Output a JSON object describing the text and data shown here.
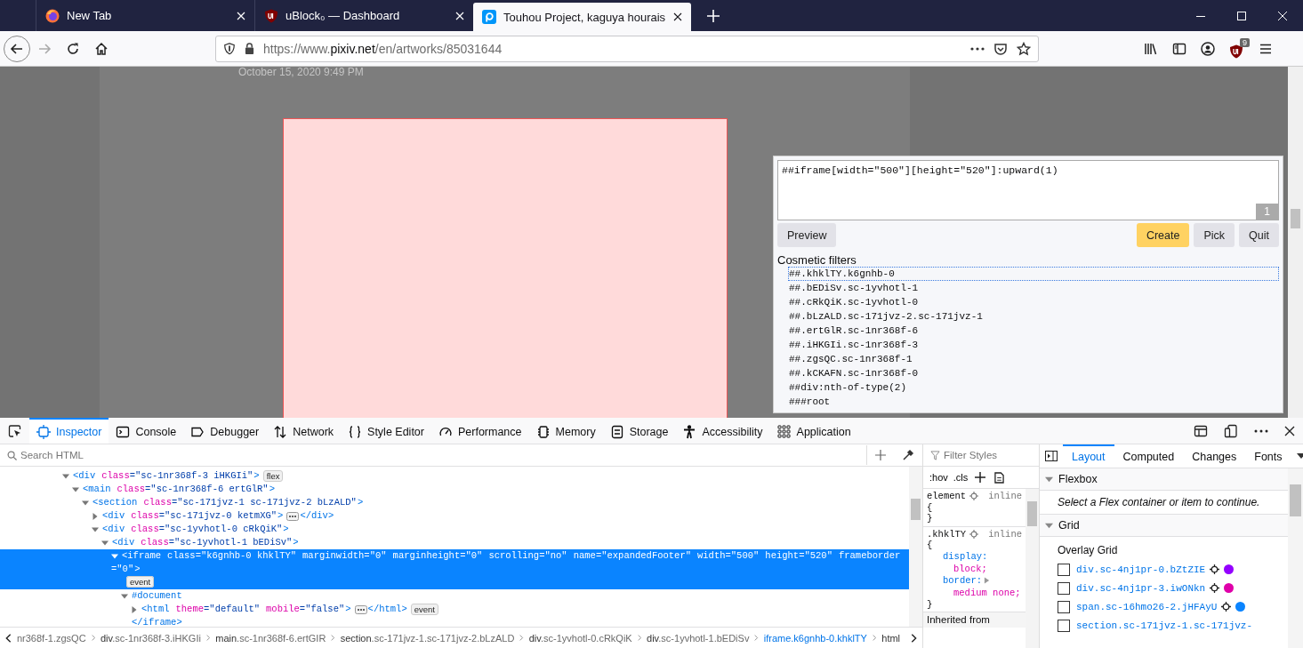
{
  "tabs": [
    {
      "title": "New Tab",
      "selected": false
    },
    {
      "title": "uBlock₀ — Dashboard",
      "selected": false
    },
    {
      "title": "Touhou Project, kaguya hourais",
      "selected": true
    }
  ],
  "address": {
    "prefix": "https://www.",
    "domain": "pixiv.net",
    "path": "/en/artworks/85031644"
  },
  "extension_badge": "9",
  "page": {
    "date": "October 15, 2020 9:49 PM"
  },
  "picker": {
    "filter": "##iframe[width=\"500\"][height=\"520\"]:upward(1)",
    "count": "1",
    "buttons": [
      {
        "label": "Preview",
        "kind": "plain"
      },
      {
        "label": "Create",
        "kind": "primary"
      },
      {
        "label": "Pick",
        "kind": "plain"
      },
      {
        "label": "Quit",
        "kind": "plain"
      }
    ],
    "section_title": "Cosmetic filters",
    "filters": [
      {
        "text": "##.khklTY.k6gnhb-0",
        "selected": true
      },
      {
        "text": "##.bEDiSv.sc-1yvhotl-1",
        "selected": false
      },
      {
        "text": "##.cRkQiK.sc-1yvhotl-0",
        "selected": false
      },
      {
        "text": "##.bLzALD.sc-171jvz-2.sc-171jvz-1",
        "selected": false
      },
      {
        "text": "##.ertGlR.sc-1nr368f-6",
        "selected": false
      },
      {
        "text": "##.iHKGIi.sc-1nr368f-3",
        "selected": false
      },
      {
        "text": "##.zgsQC.sc-1nr368f-1",
        "selected": false
      },
      {
        "text": "##.kCKAFN.sc-1nr368f-0",
        "selected": false
      },
      {
        "text": "##div:nth-of-type(2)",
        "selected": false
      },
      {
        "text": "###root",
        "selected": false
      }
    ]
  },
  "devtools": {
    "tools": [
      {
        "label": "Inspector",
        "selected": true
      },
      {
        "label": "Console",
        "selected": false
      },
      {
        "label": "Debugger",
        "selected": false
      },
      {
        "label": "Network",
        "selected": false
      },
      {
        "label": "Style Editor",
        "selected": false
      },
      {
        "label": "Performance",
        "selected": false
      },
      {
        "label": "Memory",
        "selected": false
      },
      {
        "label": "Storage",
        "selected": false
      },
      {
        "label": "Accessibility",
        "selected": false
      },
      {
        "label": "Application",
        "selected": false
      }
    ],
    "search_placeholder": "Search HTML",
    "tree": [
      {
        "kind": "element",
        "open": "<div",
        "attributes": [
          {
            "name": "class",
            "value": "=\"sc-1nr368f-3 iHKGIi\""
          }
        ],
        "end": ">",
        "badges": [
          "flex"
        ],
        "expanded": true,
        "selected": false,
        "children": [
          {
            "kind": "element",
            "open": "<main",
            "attributes": [
              {
                "name": "class",
                "value": "=\"sc-1nr368f-6 ertGlR\""
              }
            ],
            "end": ">",
            "expanded": true,
            "selected": false,
            "children": [
              {
                "kind": "element",
                "open": "<section",
                "attributes": [
                  {
                    "name": "class",
                    "value": "=\"sc-171jvz-1 sc-171jvz-2 bLzALD\""
                  }
                ],
                "end": ">",
                "expanded": true,
                "selected": false,
                "children": [
                  {
                    "kind": "element",
                    "open": "<div",
                    "attributes": [
                      {
                        "name": "class",
                        "value": "=\"sc-171jvz-0 ketmXG\""
                      }
                    ],
                    "end": ">",
                    "close": "</div>",
                    "expanded": false,
                    "selected": false
                  },
                  {
                    "kind": "element",
                    "open": "<div",
                    "attributes": [
                      {
                        "name": "class",
                        "value": "=\"sc-1yvhotl-0 cRkQiK\""
                      }
                    ],
                    "end": ">",
                    "expanded": true,
                    "selected": false,
                    "children": [
                      {
                        "kind": "element",
                        "open": "<div",
                        "attributes": [
                          {
                            "name": "class",
                            "value": "=\"sc-1yvhotl-1 bEDiSv\""
                          }
                        ],
                        "end": ">",
                        "expanded": true,
                        "selected": false,
                        "children": [
                          {
                            "kind": "element",
                            "open": "<iframe",
                            "attributes": [
                              {
                                "name": "class",
                                "value": "=\"k6gnhb-0 khklTY\""
                              },
                              {
                                "name": "marginwidth",
                                "value": "=\"0\""
                              },
                              {
                                "name": "marginheight",
                                "value": "=\"0\""
                              },
                              {
                                "name": "scrolling",
                                "value": "=\"no\""
                              },
                              {
                                "name": "name",
                                "value": "=\"expandedFooter\""
                              },
                              {
                                "name": "width",
                                "value": "=\"500\""
                              },
                              {
                                "name": "height",
                                "value": "=\"520\""
                              },
                              {
                                "name": "frameborder",
                                "value": "=\"0\""
                              }
                            ],
                            "end": ">",
                            "badges": [
                              "event"
                            ],
                            "expanded": true,
                            "selected": true,
                            "children": [
                              {
                                "kind": "document",
                                "label": "#document",
                                "expanded": true,
                                "selected": false,
                                "children": [
                                  {
                                    "kind": "element",
                                    "open": "<html",
                                    "attributes": [
                                      {
                                        "name": "theme",
                                        "value": "=\"default\""
                                      },
                                      {
                                        "name": "mobile",
                                        "value": "=\"false\""
                                      }
                                    ],
                                    "end": ">",
                                    "close": "</html>",
                                    "badges": [
                                      "event"
                                    ],
                                    "expanded": false,
                                    "selected": false
                                  }
                                ]
                              },
                              {
                                "kind": "close",
                                "label": "</iframe>"
                              }
                            ]
                          }
                        ]
                      }
                    ]
                  }
                ]
              }
            ]
          }
        ]
      }
    ],
    "breadcrumbs": [
      {
        "classes": "nr368f-1.zgsQC",
        "selected": false
      },
      {
        "element": "div",
        "classes": ".sc-1nr368f-3.iHKGIi",
        "selected": false
      },
      {
        "element": "main",
        "classes": ".sc-1nr368f-6.ertGIR",
        "selected": false
      },
      {
        "element": "section",
        "classes": ".sc-171jvz-1.sc-171jvz-2.bLzALD",
        "selected": false
      },
      {
        "element": "div",
        "classes": ".sc-1yvhotl-0.cRkQiK",
        "selected": false
      },
      {
        "element": "div",
        "classes": ".sc-1yvhotl-1.bEDiSv",
        "selected": false
      },
      {
        "element": "iframe",
        "classes": ".k6gnhb-0.khklTY",
        "selected": true
      },
      {
        "element": "html",
        "selected": false
      }
    ],
    "rules": {
      "filter_placeholder": "Filter Styles",
      "toggles": [
        ":hov",
        ".cls"
      ],
      "items": [
        {
          "selector": "element",
          "source": "inline",
          "open": "{",
          "close": "}"
        },
        {
          "selector": ".khklTY",
          "source": "inline",
          "open": "{",
          "close": "}",
          "declarations": [
            {
              "property": "display:",
              "value": "block;",
              "expandable": false
            },
            {
              "property": "border:",
              "value": "medium none;",
              "expandable": true
            }
          ]
        }
      ],
      "inherited": "Inherited from"
    },
    "sidebar": {
      "tabs": [
        {
          "label": "Layout",
          "selected": true
        },
        {
          "label": "Computed",
          "selected": false
        },
        {
          "label": "Changes",
          "selected": false
        },
        {
          "label": "Fonts",
          "selected": false
        }
      ],
      "flexbox": {
        "title": "Flexbox",
        "expanded": true,
        "message": "Select a Flex container or item to continue."
      },
      "grid": {
        "title": "Grid",
        "expanded": true,
        "subtitle": "Overlay Grid",
        "items": [
          {
            "label": "div.sc-4nj1pr-0.bZtZIE",
            "checked": false,
            "color": "#9400ff"
          },
          {
            "label": "div.sc-4nj1pr-3.iwONkn",
            "checked": false,
            "color": "#df00a9"
          },
          {
            "label": "span.sc-16hmo26-2.jHFAyU",
            "checked": false,
            "color": "#0a84ff"
          },
          {
            "label": "section.sc-171jvz-1.sc-171jvz-",
            "checked": false
          }
        ]
      }
    }
  }
}
